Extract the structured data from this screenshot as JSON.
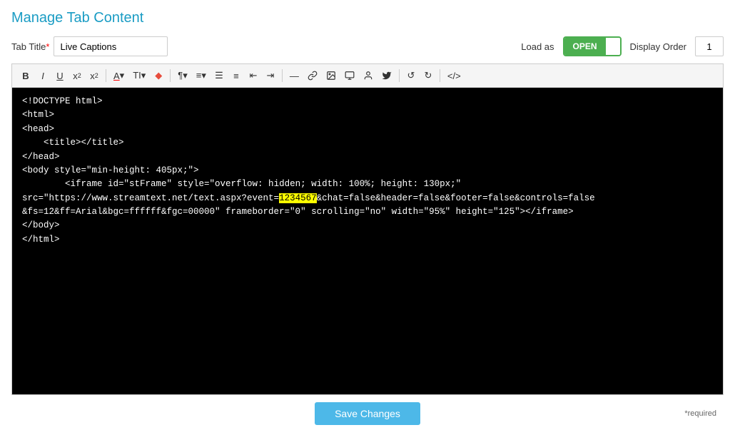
{
  "page": {
    "title": "Manage Tab Content"
  },
  "top_bar": {
    "tab_title_label": "Tab Title",
    "tab_title_value": "Live Captions",
    "load_as_label": "Load as",
    "toggle_open": "OPEN",
    "toggle_closed": "",
    "display_order_label": "Display Order",
    "display_order_value": "1"
  },
  "toolbar": {
    "bold": "B",
    "italic": "I",
    "underline": "U",
    "subscript": "x₂",
    "superscript": "x²",
    "font_color": "A",
    "font_size": "TI",
    "highlight_color": "◆",
    "paragraph": "¶",
    "align": "≡",
    "unordered_list": "≡",
    "ordered_list": "≡",
    "indent_left": "⇤",
    "indent_right": "⇥",
    "hr": "—",
    "link": "🔗",
    "image": "🖼",
    "video": "▶",
    "contact": "👤",
    "twitter": "🐦",
    "undo": "↺",
    "redo": "↻",
    "source": "</>",
    "save_button": "Save Changes",
    "required_note": "*required"
  },
  "code_content": {
    "line1": "<!DOCTYPE html>",
    "line2": "<html>",
    "line3": "<head>",
    "line4": "    <title></title>",
    "line5": "</head>",
    "line6": "<body style=\"min-height: 405px;\">",
    "line7_pre": "        <iframe id=\"stFrame\" style=\"overflow: hidden; width: 100%; height: 130px;\"",
    "line8_pre": "src=\"https://www.streamtext.net/text.aspx?event=",
    "highlight": "1234567",
    "line8_post": "&chat=false&header=false&footer=false&controls=false",
    "line9": "&fs=12&ff=Arial&bgc=ffffff&fgc=00000\" frameborder=\"0\" scrolling=\"no\" width=\"95%\" height=\"125\"></iframe>",
    "line10": "</body>",
    "line11": "</html>"
  }
}
